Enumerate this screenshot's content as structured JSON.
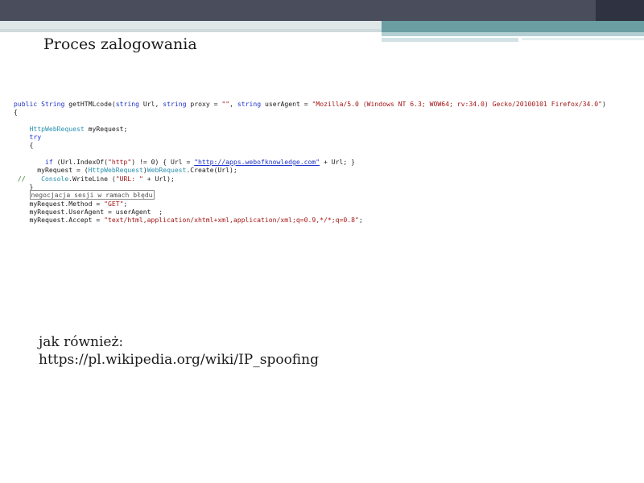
{
  "slide": {
    "title": "Proces zalogowania",
    "note_line1": "jak również:",
    "note_line2": "https://pl.wikipedia.org/wiki/IP_spoofing"
  },
  "code": {
    "lines": [
      [
        {
          "t": "public ",
          "c": "kw"
        },
        {
          "t": "String ",
          "c": "kw"
        },
        {
          "t": "getHTMLcode(",
          "c": ""
        },
        {
          "t": "string ",
          "c": "kw"
        },
        {
          "t": "Url, ",
          "c": ""
        },
        {
          "t": "string ",
          "c": "kw"
        },
        {
          "t": "proxy = ",
          "c": ""
        },
        {
          "t": "\"\"",
          "c": "str"
        },
        {
          "t": ", ",
          "c": ""
        },
        {
          "t": "string ",
          "c": "kw"
        },
        {
          "t": "userAgent = ",
          "c": ""
        },
        {
          "t": "\"Mozilla/5.0 (Windows NT 6.3; WOW64; rv:34.0) Gecko/20100101 Firefox/34.0\"",
          "c": "str"
        },
        {
          "t": ")",
          "c": ""
        }
      ],
      [
        {
          "t": "{",
          "c": ""
        }
      ],
      [
        {
          "t": "",
          "c": ""
        }
      ],
      [
        {
          "t": "    ",
          "c": ""
        },
        {
          "t": "HttpWebRequest ",
          "c": "ty"
        },
        {
          "t": "myRequest;",
          "c": ""
        }
      ],
      [
        {
          "t": "    ",
          "c": ""
        },
        {
          "t": "try",
          "c": "kw"
        }
      ],
      [
        {
          "t": "    {",
          "c": ""
        }
      ],
      [
        {
          "t": "",
          "c": ""
        }
      ],
      [
        {
          "t": "        ",
          "c": ""
        },
        {
          "t": "if ",
          "c": "kw"
        },
        {
          "t": "(Url.IndexOf(",
          "c": ""
        },
        {
          "t": "\"http\"",
          "c": "str"
        },
        {
          "t": ") != 0) { Url = ",
          "c": ""
        },
        {
          "t": "\"http://apps.webofknowledge.com\"",
          "c": "url"
        },
        {
          "t": " + Url; }",
          "c": ""
        }
      ],
      [
        {
          "t": "      myRequest = (",
          "c": ""
        },
        {
          "t": "HttpWebRequest",
          "c": "ty"
        },
        {
          "t": ")",
          "c": ""
        },
        {
          "t": "WebRequest",
          "c": "ty"
        },
        {
          "t": ".Create(Url);",
          "c": ""
        }
      ],
      [
        {
          "t": " //    ",
          "c": "cm"
        },
        {
          "t": "Console",
          "c": "ty"
        },
        {
          "t": ".WriteLine (",
          "c": ""
        },
        {
          "t": "\"URL: \"",
          "c": "str"
        },
        {
          "t": " + Url);",
          "c": ""
        }
      ],
      [
        {
          "t": "    }",
          "c": ""
        }
      ],
      [
        {
          "t": "    ",
          "c": ""
        },
        {
          "t": "negocjacja sesji w ramach błędu",
          "c": "boxed"
        }
      ],
      [
        {
          "t": "    myRequest.Method = ",
          "c": ""
        },
        {
          "t": "\"GET\"",
          "c": "str"
        },
        {
          "t": ";",
          "c": ""
        }
      ],
      [
        {
          "t": "    myRequest.UserAgent = userAgent  ;",
          "c": ""
        }
      ],
      [
        {
          "t": "    myRequest.Accept = ",
          "c": ""
        },
        {
          "t": "\"text/html,application/xhtml+xml,application/xml;q=0.9,*/*;q=0.8\"",
          "c": "str"
        },
        {
          "t": ";",
          "c": ""
        }
      ]
    ]
  }
}
